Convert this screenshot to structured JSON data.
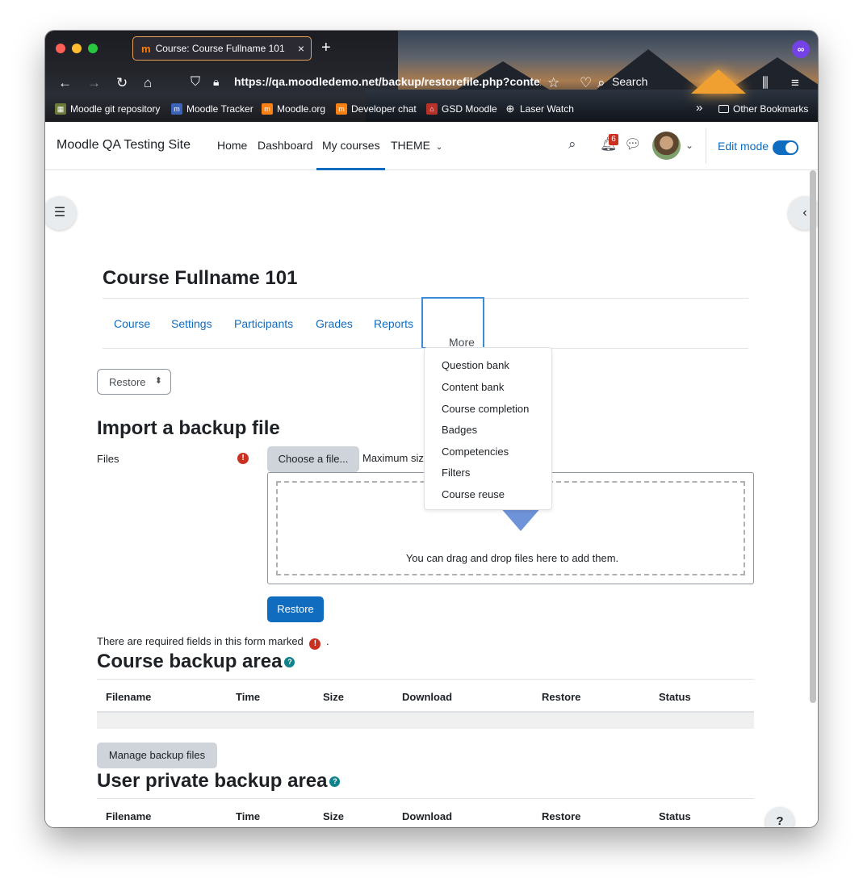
{
  "browser": {
    "tab_title": "Course: Course Fullname 101",
    "tab_favicon": "m",
    "tab_close": "×",
    "new_tab": "+",
    "url": "https://qa.moodledemo.net/backup/restorefile.php?contexti",
    "search_label": "Search",
    "bookmarks": [
      {
        "label": "Moodle git repository",
        "icon": "git-icon",
        "color": "#6c7a3a"
      },
      {
        "label": "Moodle Tracker",
        "icon": "tracker-icon",
        "color": "#3c63b8"
      },
      {
        "label": "Moodle.org",
        "icon": "moodle-icon",
        "color": "#f98012"
      },
      {
        "label": "Developer chat",
        "icon": "moodle-icon",
        "color": "#f98012"
      },
      {
        "label": "GSD Moodle",
        "icon": "school-icon",
        "color": "#b8322a"
      },
      {
        "label": "Laser Watch",
        "icon": "globe-icon",
        "color": "transparent"
      }
    ],
    "overflow": "»",
    "other_bookmarks": "Other Bookmarks"
  },
  "topbar": {
    "site_name": "Moodle QA Testing Site",
    "nav": [
      "Home",
      "Dashboard",
      "My courses",
      "THEME"
    ],
    "notification_count": "6",
    "edit_mode_label": "Edit mode",
    "accent": "#0f6cbf"
  },
  "course": {
    "title": "Course Fullname 101",
    "secondary_nav": [
      "Course",
      "Settings",
      "Participants",
      "Grades",
      "Reports"
    ],
    "more_label": "More",
    "more_menu": [
      "Question bank",
      "Content bank",
      "Course completion",
      "Badges",
      "Competencies",
      "Filters",
      "Course reuse"
    ]
  },
  "restore_select": {
    "value": "Restore",
    "arrows": "⬍"
  },
  "import": {
    "heading": "Import a backup file",
    "files_label": "Files",
    "choose_button": "Choose a file...",
    "max_size": "Maximum siz",
    "drop_text": "You can drag and drop files here to add them.",
    "restore_button": "Restore",
    "required_note": "There are required fields in this form marked",
    "required_note_end": "."
  },
  "course_backup": {
    "heading": "Course backup area",
    "columns": [
      "Filename",
      "Time",
      "Size",
      "Download",
      "Restore",
      "Status"
    ],
    "manage_button": "Manage backup files"
  },
  "user_backup": {
    "heading": "User private backup area",
    "columns": [
      "Filename",
      "Time",
      "Size",
      "Download",
      "Restore",
      "Status"
    ]
  },
  "help_float": "?"
}
